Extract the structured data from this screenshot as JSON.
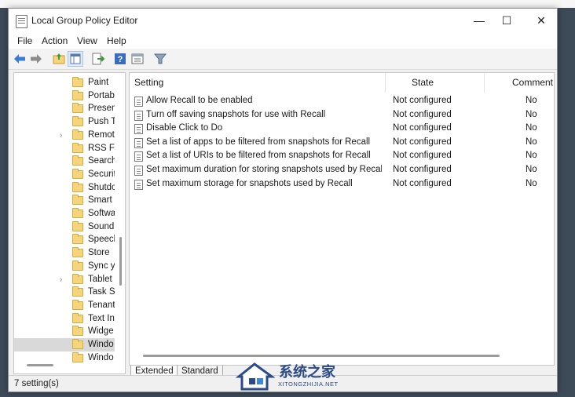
{
  "window": {
    "title": "Local Group Policy Editor",
    "controls": {
      "minimize": "—",
      "maximize": "☐",
      "close": "✕"
    }
  },
  "menu": [
    "File",
    "Action",
    "View",
    "Help"
  ],
  "toolbar": {
    "buttons": [
      "back-icon",
      "forward-icon",
      "up-folder-icon",
      "show-hide-tree-icon",
      "export-list-icon",
      "help-icon",
      "properties-icon",
      "filter-icon"
    ]
  },
  "tree": {
    "items": [
      {
        "label": "Paint",
        "expandable": false
      },
      {
        "label": "Portab",
        "expandable": false
      },
      {
        "label": "Presen",
        "expandable": false
      },
      {
        "label": "Push T",
        "expandable": false
      },
      {
        "label": "Remot",
        "expandable": true
      },
      {
        "label": "RSS Fe",
        "expandable": false
      },
      {
        "label": "Search",
        "expandable": false
      },
      {
        "label": "Securit",
        "expandable": false
      },
      {
        "label": "Shutdo",
        "expandable": false
      },
      {
        "label": "Smart (",
        "expandable": false
      },
      {
        "label": "Softwa",
        "expandable": false
      },
      {
        "label": "Sound",
        "expandable": false
      },
      {
        "label": "Speech",
        "expandable": false
      },
      {
        "label": "Store",
        "expandable": false
      },
      {
        "label": "Sync yc",
        "expandable": false
      },
      {
        "label": "Tablet",
        "expandable": true
      },
      {
        "label": "Task Sc",
        "expandable": false
      },
      {
        "label": "Tenant",
        "expandable": false
      },
      {
        "label": "Text In",
        "expandable": false
      },
      {
        "label": "Widge",
        "expandable": false
      },
      {
        "label": "Windo",
        "expandable": false,
        "selected": true
      },
      {
        "label": "Windo",
        "expandable": false
      }
    ]
  },
  "details": {
    "columns": {
      "setting": "Setting",
      "state": "State",
      "comment": "Comment"
    },
    "rows": [
      {
        "setting": "Allow Recall to be enabled",
        "state": "Not configured",
        "comment": "No"
      },
      {
        "setting": "Turn off saving snapshots for use with Recall",
        "state": "Not configured",
        "comment": "No"
      },
      {
        "setting": "Disable Click to Do",
        "state": "Not configured",
        "comment": "No"
      },
      {
        "setting": "Set a list of apps to be filtered from snapshots for Recall",
        "state": "Not configured",
        "comment": "No"
      },
      {
        "setting": "Set a list of URIs to be filtered from snapshots for Recall",
        "state": "Not configured",
        "comment": "No"
      },
      {
        "setting": "Set maximum duration for storing snapshots used by Recall ...",
        "state": "Not configured",
        "comment": "No"
      },
      {
        "setting": "Set maximum storage for snapshots used by Recall",
        "state": "Not configured",
        "comment": "No"
      }
    ]
  },
  "tabs": [
    {
      "label": "Extended",
      "active": false
    },
    {
      "label": "Standard",
      "active": true
    }
  ],
  "status": {
    "text": "7 setting(s)"
  },
  "watermark": {
    "name": "系统之家",
    "url": "XITONGZHIJIA.NET"
  },
  "colors": {
    "folder": "#f4d57e",
    "selection": "#d9d9d9",
    "watermark": "#2b4a86"
  }
}
